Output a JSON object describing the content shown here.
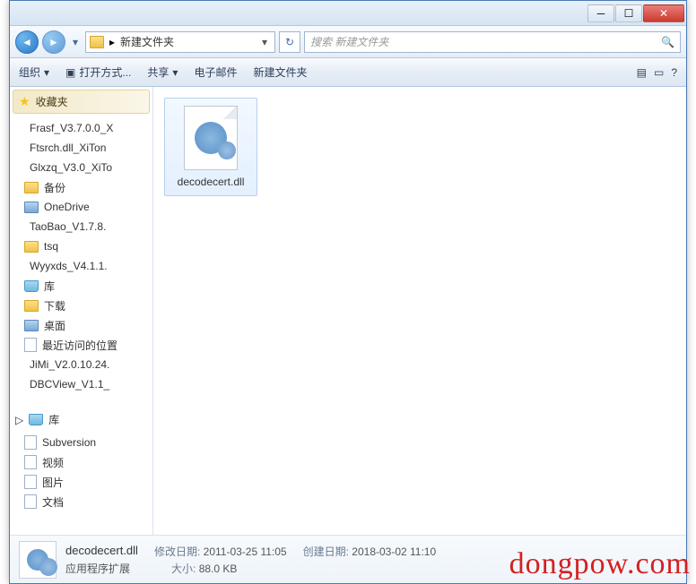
{
  "titlebar": {
    "min": "─",
    "max": "☐",
    "close": "✕"
  },
  "nav": {
    "back": "◄",
    "fwd": "►",
    "drop": "▾"
  },
  "address": {
    "path": "新建文件夹",
    "drop": "▾",
    "refresh": "↻"
  },
  "search": {
    "placeholder": "搜索 新建文件夹",
    "icon": "🔍"
  },
  "toolbar": {
    "organize": "组织",
    "drop": "▾",
    "openwith": "打开方式...",
    "share": "共享",
    "email": "电子邮件",
    "newfolder": "新建文件夹",
    "view": "▤",
    "preview": "▭",
    "help": "?"
  },
  "sidebar": {
    "favorites_label": "收藏夹",
    "favorites": [
      {
        "icon": "rar",
        "label": "Frasf_V3.7.0.0_X"
      },
      {
        "icon": "rar",
        "label": "Ftsrch.dll_XiTon"
      },
      {
        "icon": "rar",
        "label": "Glxzq_V3.0_XiTo"
      },
      {
        "icon": "fldr",
        "label": "备份"
      },
      {
        "icon": "drv",
        "label": "OneDrive"
      },
      {
        "icon": "rar",
        "label": "TaoBao_V1.7.8."
      },
      {
        "icon": "fldr",
        "label": "tsq"
      },
      {
        "icon": "rar",
        "label": "Wyyxds_V4.1.1."
      },
      {
        "icon": "lib",
        "label": "库"
      },
      {
        "icon": "fldr",
        "label": "下载"
      },
      {
        "icon": "drv",
        "label": "桌面"
      },
      {
        "icon": "doc",
        "label": "最近访问的位置"
      },
      {
        "icon": "rar",
        "label": "JiMi_V2.0.10.24."
      },
      {
        "icon": "rar",
        "label": "DBCView_V1.1_"
      }
    ],
    "library_label": "库",
    "libraries": [
      {
        "icon": "doc",
        "label": "Subversion"
      },
      {
        "icon": "doc",
        "label": "视频"
      },
      {
        "icon": "doc",
        "label": "图片"
      },
      {
        "icon": "doc",
        "label": "文档"
      }
    ]
  },
  "content": {
    "files": [
      {
        "name": "decodecert.dll"
      }
    ]
  },
  "details": {
    "name": "decodecert.dll",
    "type": "应用程序扩展",
    "mod_label": "修改日期:",
    "mod_value": "2011-03-25 11:05",
    "size_label": "大小:",
    "size_value": "88.0 KB",
    "create_label": "创建日期:",
    "create_value": "2018-03-02 11:10"
  },
  "watermark": "dongpow.com"
}
